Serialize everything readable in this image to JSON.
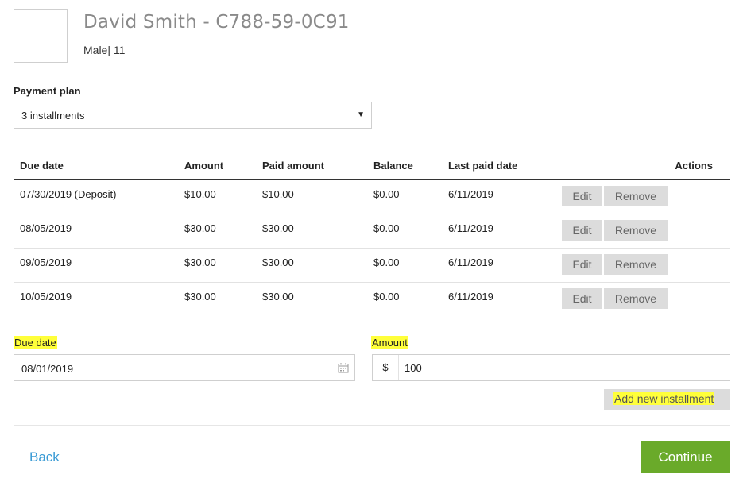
{
  "patient": {
    "name": "David Smith - C788-59-0C91",
    "meta": "Male| 11"
  },
  "payment_plan": {
    "label": "Payment plan",
    "selected": "3 installments"
  },
  "table": {
    "headers": {
      "due_date": "Due date",
      "amount": "Amount",
      "paid_amount": "Paid amount",
      "balance": "Balance",
      "last_paid_date": "Last paid date",
      "actions": "Actions"
    },
    "rows": [
      {
        "due_date": "07/30/2019 (Deposit)",
        "amount": "$10.00",
        "paid_amount": "$10.00",
        "balance": "$0.00",
        "last_paid_date": "6/11/2019"
      },
      {
        "due_date": "08/05/2019",
        "amount": "$30.00",
        "paid_amount": "$30.00",
        "balance": "$0.00",
        "last_paid_date": "6/11/2019"
      },
      {
        "due_date": "09/05/2019",
        "amount": "$30.00",
        "paid_amount": "$30.00",
        "balance": "$0.00",
        "last_paid_date": "6/11/2019"
      },
      {
        "due_date": "10/05/2019",
        "amount": "$30.00",
        "paid_amount": "$30.00",
        "balance": "$0.00",
        "last_paid_date": "6/11/2019"
      }
    ],
    "edit_label": "Edit",
    "remove_label": "Remove"
  },
  "form": {
    "due_date_label": "Due date",
    "due_date_value": "08/01/2019",
    "amount_label": "Amount",
    "currency_symbol": "$",
    "amount_value": "100",
    "add_button": "Add new installment",
    "highlight_color": "#ffff3a"
  },
  "footer": {
    "back": "Back",
    "continue": "Continue",
    "accent_color": "#6aaa2a",
    "link_color": "#3a9bd5"
  }
}
